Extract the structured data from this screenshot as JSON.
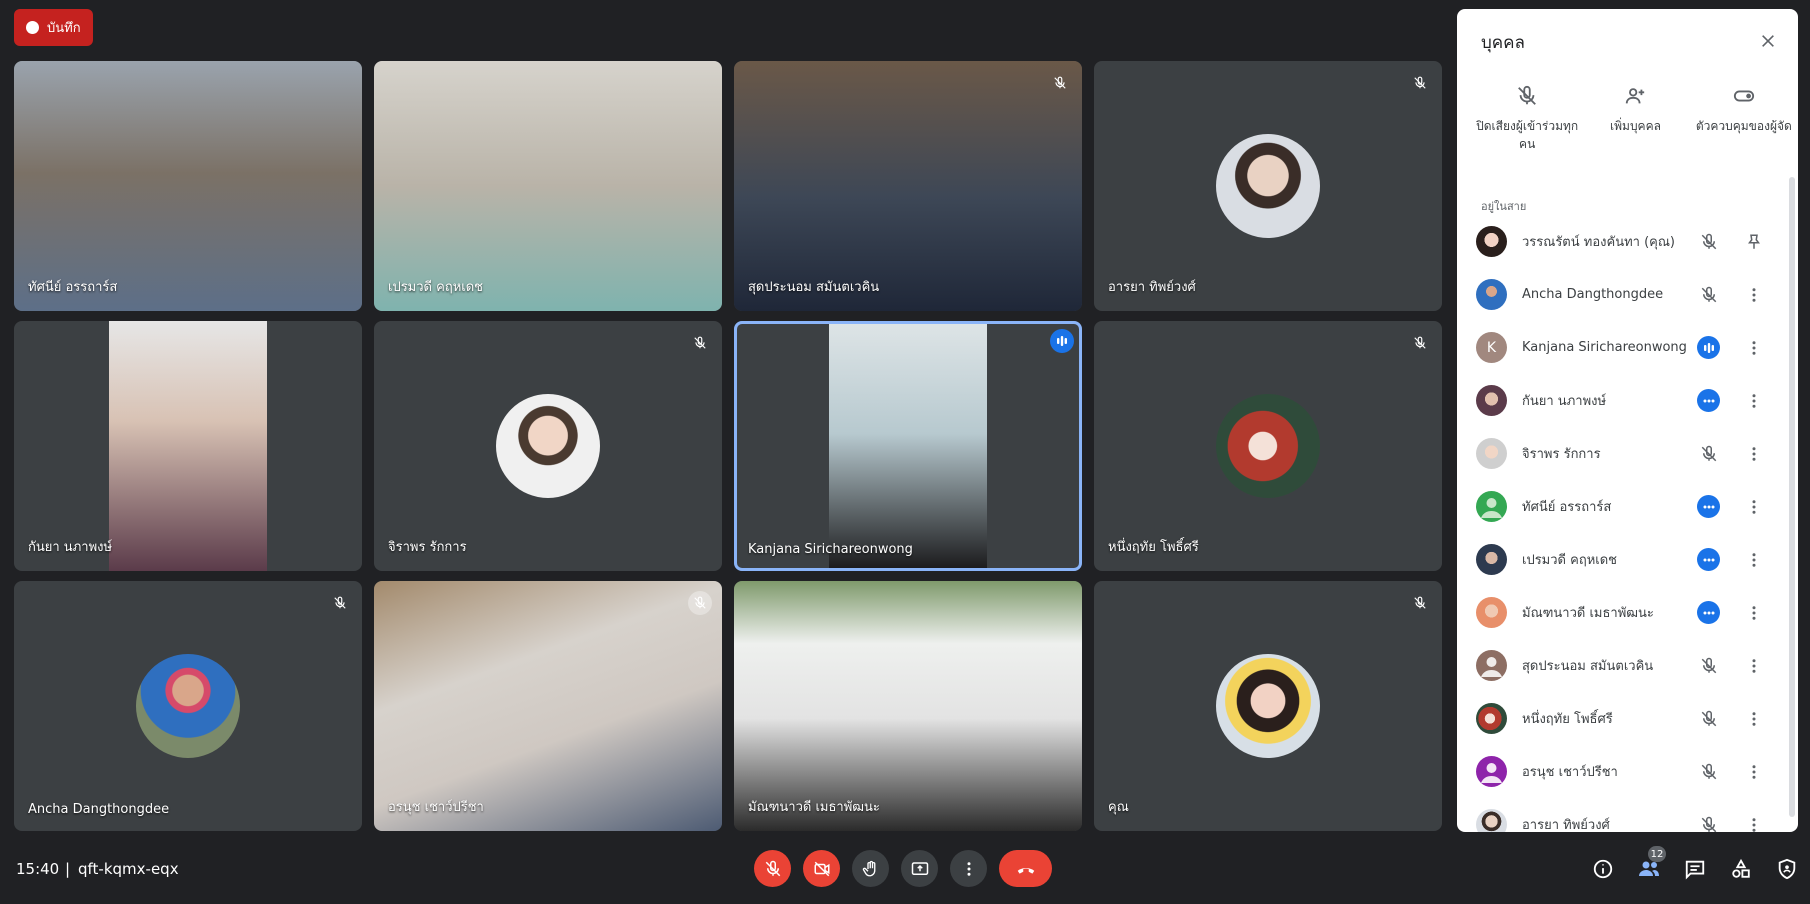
{
  "recording": {
    "label": "บันทึก"
  },
  "tiles": [
    {
      "name": "ทัศนีย์ อรรถาร์ส",
      "muted": false
    },
    {
      "name": "เปรมวดี คฤหเดช",
      "muted": false
    },
    {
      "name": "สุดประนอม สมันตเวคิน",
      "muted": true
    },
    {
      "name": "อารยา ทิพย์วงศ์",
      "muted": true
    },
    {
      "name": "กันยา นภาพงษ์",
      "muted": false
    },
    {
      "name": "จิราพร รักการ",
      "muted": true
    },
    {
      "name": "Kanjana Sirichareonwong",
      "speaking": true
    },
    {
      "name": "หนึ่งฤทัย โพธิ์ศรี",
      "muted": true
    },
    {
      "name": "Ancha Dangthongdee",
      "muted": true
    },
    {
      "name": "อรนุช เชาว์ปรีชา",
      "muted": true
    },
    {
      "name": "มัณฑนาวดี เมธาพัฒนะ",
      "muted": false
    },
    {
      "name": "คุณ",
      "muted": true
    }
  ],
  "footer": {
    "time": "15:40",
    "separator": "|",
    "meeting_code": "qft-kqmx-eqx",
    "participant_count": "12"
  },
  "panel": {
    "title": "บุคคล",
    "actions": [
      {
        "label": "ปิดเสียงผู้เข้าร่วมทุกคน",
        "icon": "mic-off-icon"
      },
      {
        "label": "เพิ่มบุคคล",
        "icon": "person-add-icon"
      },
      {
        "label": "ตัวควบคุมของผู้จัด",
        "icon": "toggle-icon"
      }
    ],
    "section_label": "อยู่ในสาย",
    "participants": [
      {
        "name": "วรรณรัตน์ ทองคันทา (คุณ)",
        "status": "muted",
        "action": "pin"
      },
      {
        "name": "Ancha Dangthongdee",
        "status": "muted",
        "action": "more"
      },
      {
        "name": "Kanjana Sirichareonwong",
        "status": "speaking",
        "action": "more",
        "initial": "K"
      },
      {
        "name": "กันยา นภาพงษ์",
        "status": "dots",
        "action": "more"
      },
      {
        "name": "จิราพร รักการ",
        "status": "muted",
        "action": "more"
      },
      {
        "name": "ทัศนีย์ อรรถาร์ส",
        "status": "dots",
        "action": "more"
      },
      {
        "name": "เปรมวดี คฤหเดช",
        "status": "dots",
        "action": "more"
      },
      {
        "name": "มัณฑนาวดี เมธาพัฒนะ",
        "status": "dots",
        "action": "more"
      },
      {
        "name": "สุดประนอม สมันตเวคิน",
        "status": "muted",
        "action": "more"
      },
      {
        "name": "หนึ่งฤทัย โพธิ์ศรี",
        "status": "muted",
        "action": "more"
      },
      {
        "name": "อรนุช เชาว์ปรีชา",
        "status": "muted",
        "action": "more"
      },
      {
        "name": "อารยา ทิพย์วงศ์",
        "status": "muted",
        "action": "more"
      }
    ]
  },
  "colors": {
    "background": "#202124",
    "tile": "#3c4043",
    "accent": "#1a73e8",
    "danger": "#ea4335",
    "record": "#c5221f"
  }
}
